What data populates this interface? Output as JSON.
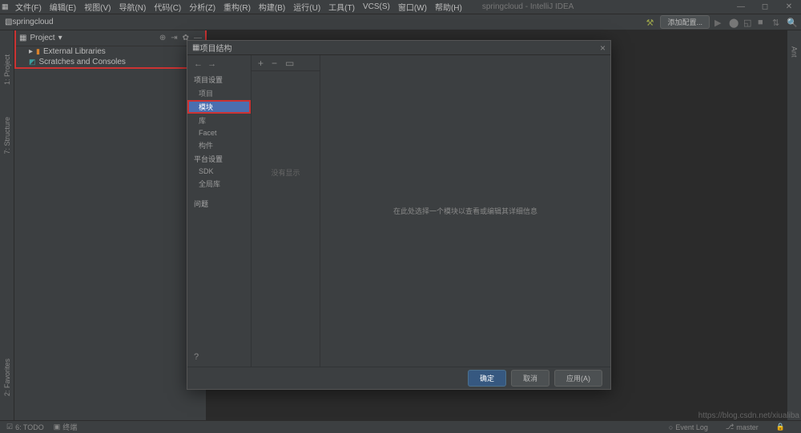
{
  "menubar": {
    "items": [
      "文件(F)",
      "编辑(E)",
      "视图(V)",
      "导航(N)",
      "代码(C)",
      "分析(Z)",
      "重构(R)",
      "构建(B)",
      "运行(U)",
      "工具(T)",
      "VCS(S)",
      "窗口(W)",
      "帮助(H)"
    ],
    "title": "springcloud - IntelliJ IDEA"
  },
  "toolbar": {
    "breadcrumb": "springcloud",
    "config_button": "添加配置..."
  },
  "project": {
    "title": "Project",
    "items": [
      {
        "label": "External Libraries"
      },
      {
        "label": "Scratches and Consoles"
      }
    ]
  },
  "left_gutter": {
    "project": "1: Project",
    "structure": "7: Structure",
    "favorites": "2: Favorites"
  },
  "right_gutter": {
    "ant": "Ant"
  },
  "dialog": {
    "title": "项目结构",
    "nav": {
      "section1": "项目设置",
      "items1": [
        "项目",
        "模块",
        "库",
        "Facet",
        "构件"
      ],
      "section2": "平台设置",
      "items2": [
        "SDK",
        "全局库"
      ],
      "section3": "问题",
      "selected_index": 1
    },
    "center_empty": "没有显示",
    "right_msg": "在此处选择一个模块以查看或编辑其详细信息",
    "buttons": {
      "ok": "确定",
      "cancel": "取消",
      "apply": "应用(A)"
    }
  },
  "statusbar": {
    "todo": "6: TODO",
    "terminal": "终端",
    "eventlog": "Event Log",
    "master": "master",
    "watermark": "https://blog.csdn.net/xiualiba"
  }
}
